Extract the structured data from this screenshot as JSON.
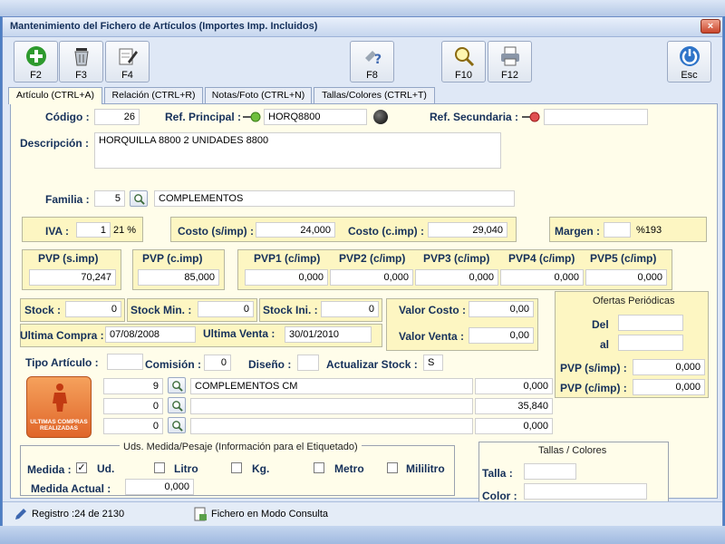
{
  "window": {
    "title": "Mantenimiento del Fichero de Artículos (Importes Imp. Incluidos)",
    "close_glyph": "×"
  },
  "toolbar": {
    "f2": "F2",
    "f3": "F3",
    "f4": "F4",
    "f8": "F8",
    "f10": "F10",
    "f12": "F12",
    "esc": "Esc"
  },
  "tabs": [
    "Artículo (CTRL+A)",
    "Relación (CTRL+R)",
    "Notas/Foto (CTRL+N)",
    "Tallas/Colores (CTRL+T)"
  ],
  "article": {
    "codigo_label": "Código :",
    "codigo": "26",
    "ref_principal_label": "Ref. Principal :",
    "ref_principal": "HORQ8800",
    "ref_secundaria_label": "Ref. Secundaria :",
    "ref_secundaria": "",
    "descripcion_label": "Descripción :",
    "descripcion": "HORQUILLA 8800 2 UNIDADES 8800",
    "familia_label": "Familia :",
    "familia_code": "5",
    "familia_name": "COMPLEMENTOS"
  },
  "prices": {
    "iva_label": "IVA :",
    "iva_code": "1",
    "iva_pct": "21 %",
    "costo_simp_label": "Costo (s/imp) :",
    "costo_simp": "24,000",
    "costo_cimp_label": "Costo (c.imp) :",
    "costo_cimp": "29,040",
    "margen_label": "Margen :",
    "margen": "",
    "margen_pct": "%193",
    "pvp_simp_label": "PVP  (s.imp)",
    "pvp_simp": "70,247",
    "pvp_cimp_label": "PVP  (c.imp)",
    "pvp_cimp": "85,000",
    "pvp1_label": "PVP1 (c/imp)",
    "pvp1": "0,000",
    "pvp2_label": "PVP2 (c/imp)",
    "pvp2": "0,000",
    "pvp3_label": "PVP3 (c/imp)",
    "pvp3": "0,000",
    "pvp4_label": "PVP4 (c/imp)",
    "pvp4": "0,000",
    "pvp5_label": "PVP5 (c/imp)",
    "pvp5": "0,000"
  },
  "stock": {
    "stock_label": "Stock :",
    "stock": "0",
    "stock_min_label": "Stock Min. :",
    "stock_min": "0",
    "stock_ini_label": "Stock Ini. :",
    "stock_ini": "0",
    "valor_costo_label": "Valor Costo :",
    "valor_costo": "0,00",
    "valor_venta_label": "Valor Venta :",
    "valor_venta": "0,00",
    "ultima_compra_label": "Ultima Compra :",
    "ultima_compra": "07/08/2008",
    "ultima_venta_label": "Ultima Venta :",
    "ultima_venta": "30/01/2010"
  },
  "ofertas": {
    "title": "Ofertas Periódicas",
    "del_label": "Del",
    "al_label": "al",
    "pvp_simp_label": "PVP (s/imp) :",
    "pvp_simp": "0,000",
    "pvp_cimp_label": "PVP (c/imp) :",
    "pvp_cimp": "0,000"
  },
  "tipo": {
    "tipo_articulo_label": "Tipo Artículo :",
    "comision_label": "Comisión :",
    "comision": "0",
    "diseno_label": "Diseño :",
    "actualizar_stock_label": "Actualizar Stock :",
    "actualizar_stock": "S"
  },
  "badge": {
    "line1": "ULTIMAS COMPRAS",
    "line2": "REALIZADAS"
  },
  "components": [
    {
      "qty": "9",
      "name": "COMPLEMENTOS CM",
      "amount": "0,000"
    },
    {
      "qty": "0",
      "name": "",
      "amount": "35,840"
    },
    {
      "qty": "0",
      "name": "",
      "amount": "0,000"
    }
  ],
  "medida": {
    "title": "Uds. Medida/Pesaje (Información para el Etiquetado)",
    "medida_label": "Medida :",
    "check_mark": "✓",
    "ud": "Ud.",
    "litro": "Litro",
    "kg": "Kg.",
    "metro": "Metro",
    "mililitro": "Mililitro",
    "medida_actual_label": "Medida Actual :",
    "medida_actual": "0,000"
  },
  "tallas": {
    "title": "Tallas / Colores",
    "talla_label": "Talla :",
    "color_label": "Color :"
  },
  "status": {
    "registro": "Registro :24  de 2130",
    "modo": "Fichero en Modo Consulta"
  },
  "colors": {
    "accent": "#15305a",
    "panel": "#fffdea",
    "box": "#fdf6c2"
  }
}
